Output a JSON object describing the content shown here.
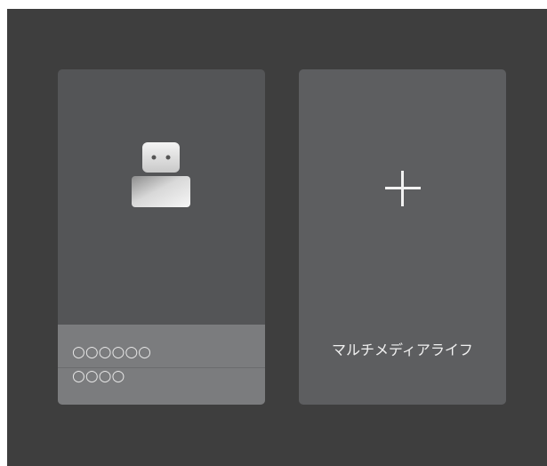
{
  "cards": {
    "usb": {
      "icon": "usb-drive-icon",
      "label_line1": "○○○○○○",
      "label_line2": "○○○○"
    },
    "add": {
      "icon": "plus-icon",
      "label": "マルチメディアライフ"
    }
  },
  "colors": {
    "background": "#3e3e3e",
    "card_usb": "#545557",
    "card_add": "#5d5e60",
    "label_area": "#7b7c7e",
    "text": "#f0f0f0"
  }
}
